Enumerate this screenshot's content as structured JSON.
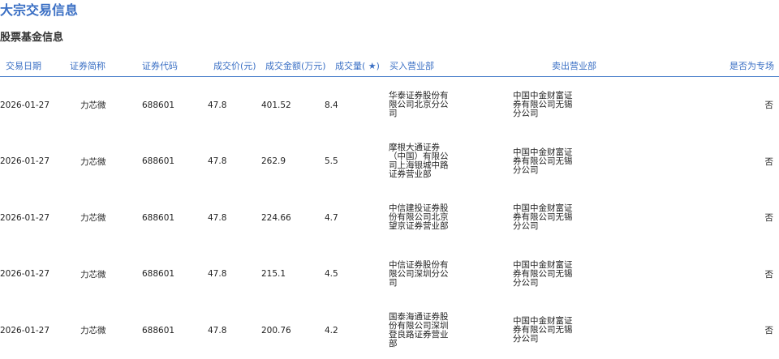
{
  "theme": {
    "accent": "#3a6fc4",
    "header_text": "#3a6fc4",
    "divider": "#4a7fcb"
  },
  "page": {
    "title": "大宗交易信息",
    "section_title": "股票基金信息"
  },
  "table": {
    "columns": [
      "交易日期",
      "证券简称",
      "证券代码",
      "成交价(元)",
      "成交金额(万元)",
      "成交量( ★)",
      "买入营业部",
      "卖出营业部",
      "是否为专场"
    ],
    "rows": [
      [
        "2026-01-27",
        "力芯微",
        "688601",
        "47.8",
        "401.52",
        "8.4",
        "华泰证券股份有限公司北京分公司",
        "中国中金财富证券有限公司无锡分公司",
        "否"
      ],
      [
        "2026-01-27",
        "力芯微",
        "688601",
        "47.8",
        "262.9",
        "5.5",
        "摩根大通证券（中国）有限公司上海银城中路证券营业部",
        "中国中金财富证券有限公司无锡分公司",
        "否"
      ],
      [
        "2026-01-27",
        "力芯微",
        "688601",
        "47.8",
        "224.66",
        "4.7",
        "中信建投证券股份有限公司北京望京证券营业部",
        "中国中金财富证券有限公司无锡分公司",
        "否"
      ],
      [
        "2026-01-27",
        "力芯微",
        "688601",
        "47.8",
        "215.1",
        "4.5",
        "中信证券股份有限公司深圳分公司",
        "中国中金财富证券有限公司无锡分公司",
        "否"
      ],
      [
        "2026-01-27",
        "力芯微",
        "688601",
        "47.8",
        "200.76",
        "4.2",
        "国泰海通证券股份有限公司深圳登良路证券营业部",
        "中国中金财富证券有限公司无锡分公司",
        "否"
      ]
    ]
  }
}
